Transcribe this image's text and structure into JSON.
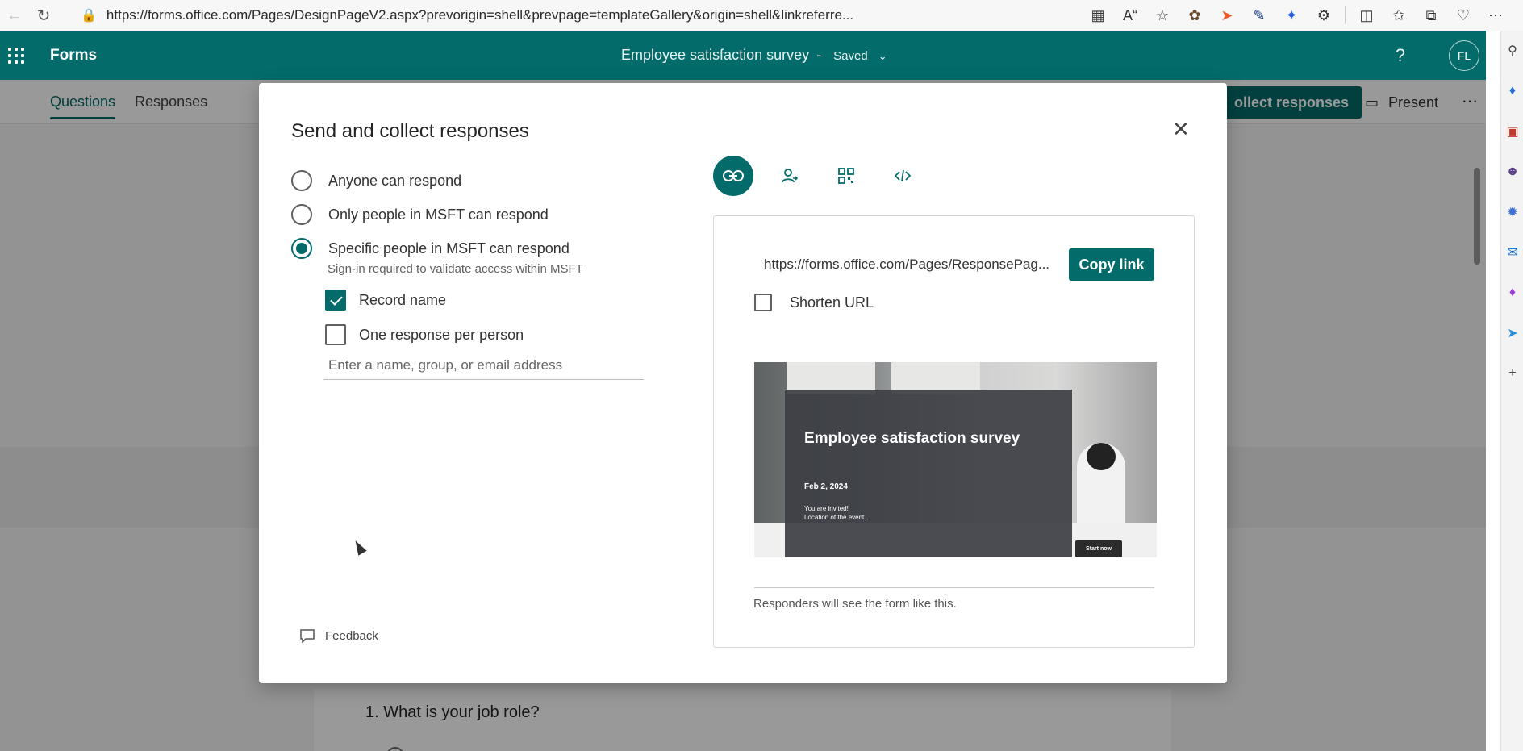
{
  "browser": {
    "url": "https://forms.office.com/Pages/DesignPageV2.aspx?prevorigin=shell&prevpage=templateGallery&origin=shell&linkreferre..."
  },
  "app": {
    "name": "Forms",
    "doc_title": "Employee satisfaction survey",
    "separator": "-",
    "save_status": "Saved",
    "avatar_initials": "FL",
    "tabs": [
      {
        "label": "Questions"
      },
      {
        "label": "Responses"
      }
    ],
    "collect_button": "ollect responses",
    "present_button": "Present",
    "question": "1. What is your job role?"
  },
  "dialog": {
    "title": "Send and collect responses",
    "options": [
      {
        "label": "Anyone can respond",
        "selected": false
      },
      {
        "label": "Only people in MSFT can respond",
        "selected": false
      },
      {
        "label": "Specific people in MSFT can respond",
        "selected": true
      }
    ],
    "option_sub": "Sign-in required to validate access within MSFT",
    "checkboxes": [
      {
        "label": "Record name",
        "checked": true
      },
      {
        "label": "One response per person",
        "checked": false
      }
    ],
    "people_input_placeholder": "Enter a name, group, or email address",
    "feedback": "Feedback",
    "share": {
      "link": "https://forms.office.com/Pages/ResponsePag...",
      "copy_button": "Copy link",
      "shorten_label": "Shorten URL",
      "shorten_checked": false,
      "preview": {
        "title": "Employee satisfaction survey",
        "date": "Feb 2, 2024",
        "invite_line1": "You are invited!",
        "invite_line2": "Location of the event.",
        "start_button": "Start now"
      },
      "preview_note": "Responders will see the form like this."
    }
  },
  "colors": {
    "brand": "#046b6b",
    "overlay": "rgba(0,0,0,0.40)"
  }
}
